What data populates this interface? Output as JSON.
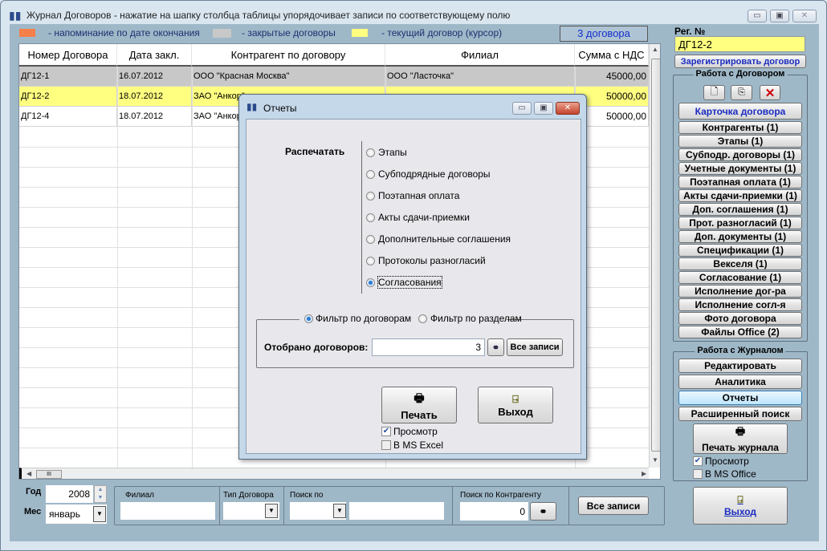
{
  "window": {
    "title": "Журнал Договоров - нажатие на шапку столбца таблицы упорядочивает записи по соответствующему полю"
  },
  "legend": [
    {
      "color": "#f47f4b",
      "label": "- напоминание по дате окончания"
    },
    {
      "color": "#c8c8c8",
      "label": "- закрытые договоры"
    },
    {
      "color": "#ffff80",
      "label": "- текущий договор (курсор)"
    }
  ],
  "count_label": "3 договора",
  "table": {
    "columns": [
      "Номер Договора",
      "Дата закл.",
      "Контрагент по договору",
      "Филиал",
      "Сумма с НДС"
    ],
    "rows": [
      {
        "cells": [
          "ДГ12-1",
          "16.07.2012",
          "ООО \"Красная Москва\"",
          "ООО \"Ласточка\"",
          "45000,00"
        ],
        "state": "closed"
      },
      {
        "cells": [
          "ДГ12-2",
          "18.07.2012",
          "ЗАО \"Анкор\"",
          "",
          "50000,00"
        ],
        "state": "current"
      },
      {
        "cells": [
          "ДГ12-4",
          "18.07.2012",
          "ЗАО \"Анкор\"",
          "",
          "50000,00"
        ],
        "state": "normal"
      }
    ]
  },
  "right": {
    "reg_label": "Рег. №",
    "reg_value": "ДГ12-2",
    "register_button": "Зарегистрировать договор",
    "contract_group": "Работа с Договором",
    "card_button": "Карточка договора",
    "contract_buttons": [
      "Контрагенты (1)",
      "Этапы (1)",
      "Субподр. договоры (1)",
      "Учетные документы (1)",
      "Поэтапная оплата (1)",
      "Акты сдачи-приемки (1)",
      "Доп. соглашения (1)",
      "Прот. разногласий (1)",
      "Доп. документы (1)",
      "Спецификации (1)",
      "Векселя (1)",
      "Согласование (1)",
      "Исполнение дог-ра",
      "Исполнение согл-я",
      "Фото договора",
      "Файлы Office (2)"
    ],
    "journal_group": "Работа с Журналом",
    "journal_buttons": [
      "Редактировать",
      "Аналитика",
      "Отчеты",
      "Расширенный поиск"
    ],
    "print_journal": "Печать журнала",
    "preview_label": "Просмотр",
    "preview_checked": true,
    "office_label": "В MS Office",
    "office_checked": false,
    "exit_label": "Выход"
  },
  "bottom": {
    "year_label": "Год",
    "year_value": "2008",
    "month_label": "Мес",
    "month_value": "январь",
    "branch_label": "Филиал",
    "branch_value": "",
    "type_label": "Тип Договора",
    "type_value": "",
    "search_label": "Поиск по",
    "search_value": "",
    "contractor_label": "Поиск по Контрагенту",
    "contractor_value": "0",
    "all_records": "Все записи"
  },
  "dialog": {
    "title": "Отчеты",
    "print_label": "Распечатать",
    "options": [
      "Этапы",
      "Субподрядные договоры",
      "Поэтапная оплата",
      "Акты сдачи-приемки",
      "Дополнительные соглашения",
      "Протоколы разногласий",
      "Согласования"
    ],
    "selected_option": "Согласования",
    "filter_by_contracts": "Фильтр по договорам",
    "filter_by_sections": "Фильтр по разделам",
    "selected_filter": "Фильтр по договорам",
    "selected_label": "Отобрано договоров:",
    "selected_value": "3",
    "all_records": "Все записи",
    "print_button": "Печать",
    "exit_button": "Выход",
    "preview_label": "Просмотр",
    "preview_checked": true,
    "excel_label": "В MS Excel",
    "excel_checked": false
  }
}
